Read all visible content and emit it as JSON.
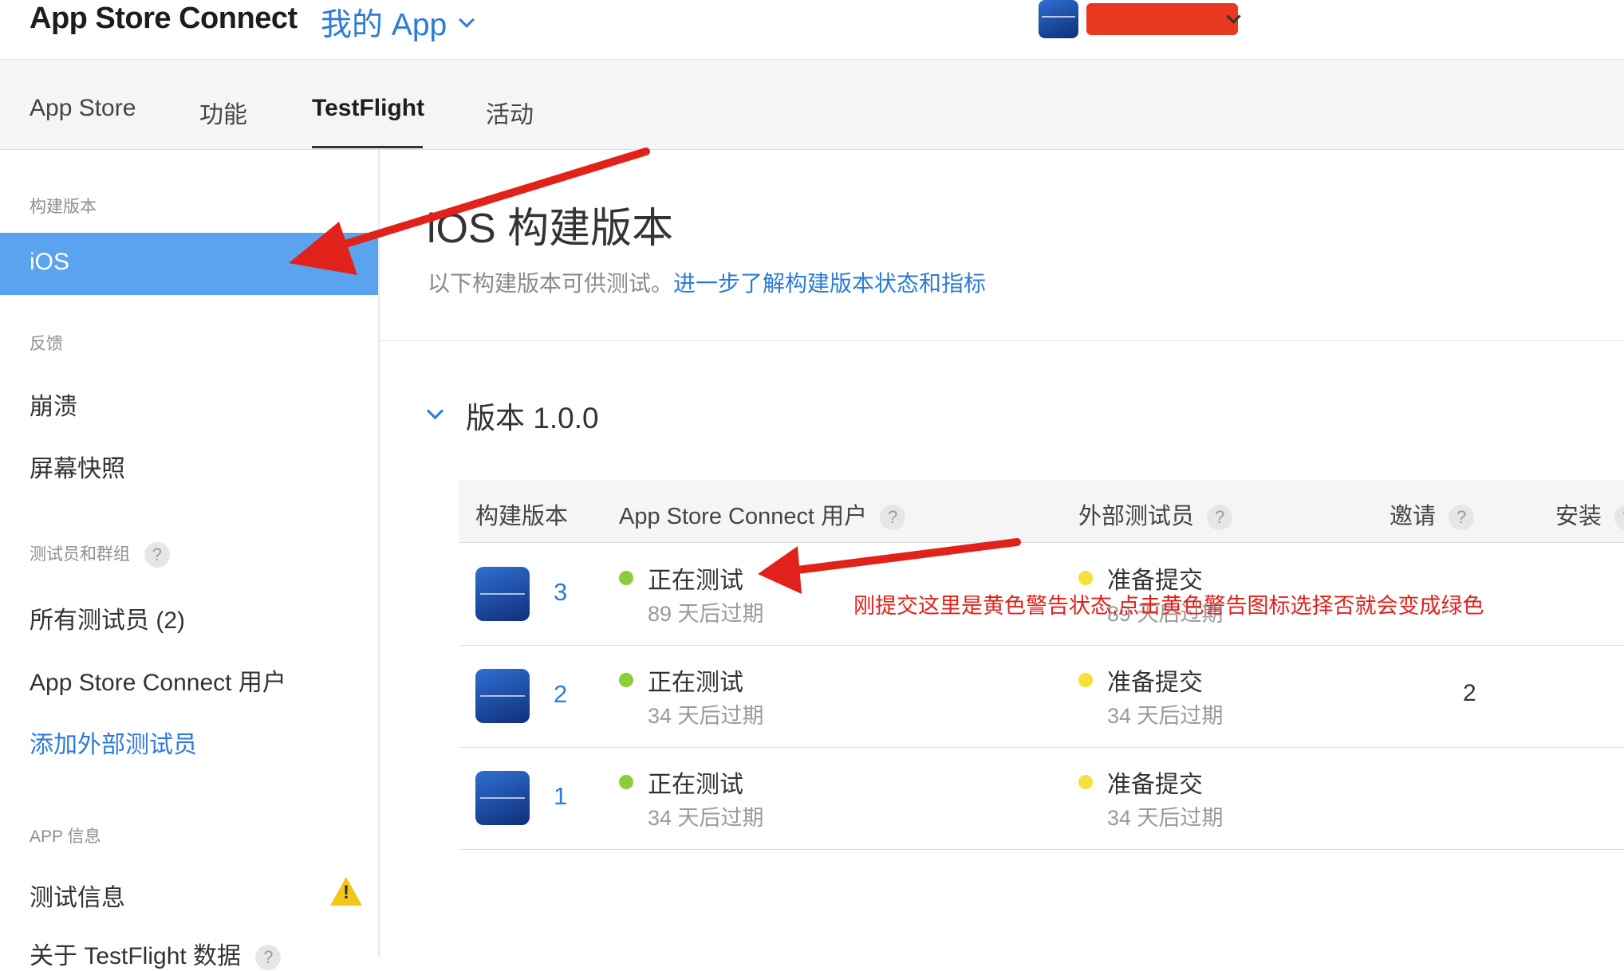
{
  "header": {
    "brand": "App Store Connect",
    "apps_menu": "我的 App",
    "account_icon": "app-logo-icon"
  },
  "tabs": [
    {
      "label": "App Store",
      "active": false
    },
    {
      "label": "功能",
      "active": false
    },
    {
      "label": "TestFlight",
      "active": true
    },
    {
      "label": "活动",
      "active": false
    }
  ],
  "sidebar": {
    "builds_heading": "构建版本",
    "ios_item": "iOS",
    "feedback_heading": "反馈",
    "crashes_item": "崩溃",
    "screenshots_item": "屏幕快照",
    "testers_heading": "测试员和群组",
    "all_testers_item": "所有测试员 (2)",
    "asc_users_item": "App Store Connect 用户",
    "add_external_item": "添加外部测试员",
    "app_info_heading": "APP 信息",
    "test_info_item": "测试信息",
    "about_item": "关于 TestFlight 数据",
    "help_badge": "?",
    "warning_mark": "!"
  },
  "main": {
    "title": "iOS 构建版本",
    "subtitle": "以下构建版本可供测试。",
    "subtitle_link": "进一步了解构建版本状态和指标",
    "version_title": "版本 1.0.0"
  },
  "table": {
    "headers": {
      "build": "构建版本",
      "asc_users": "App Store Connect 用户",
      "external": "外部测试员",
      "invites": "邀请",
      "installs": "安装",
      "help": "?"
    },
    "rows": [
      {
        "build": "3",
        "internal_status": "正在测试",
        "internal_expiry": "89 天后过期",
        "external_status": "准备提交",
        "external_expiry": "89 天后过期",
        "invites": ""
      },
      {
        "build": "2",
        "internal_status": "正在测试",
        "internal_expiry": "34 天后过期",
        "external_status": "准备提交",
        "external_expiry": "34 天后过期",
        "invites": "2"
      },
      {
        "build": "1",
        "internal_status": "正在测试",
        "internal_expiry": "34 天后过期",
        "external_status": "准备提交",
        "external_expiry": "34 天后过期",
        "invites": ""
      }
    ]
  },
  "annotation": {
    "note": "刚提交这里是黄色警告状态,点击黄色警告图标选择否就会变成绿色",
    "color": "#e1221a"
  },
  "colors": {
    "accent": "#2d7bd8",
    "selected_bg": "#5aa3ef",
    "status_green": "#8ccd3b",
    "status_yellow": "#f6e03a",
    "warning": "#f5c518"
  }
}
